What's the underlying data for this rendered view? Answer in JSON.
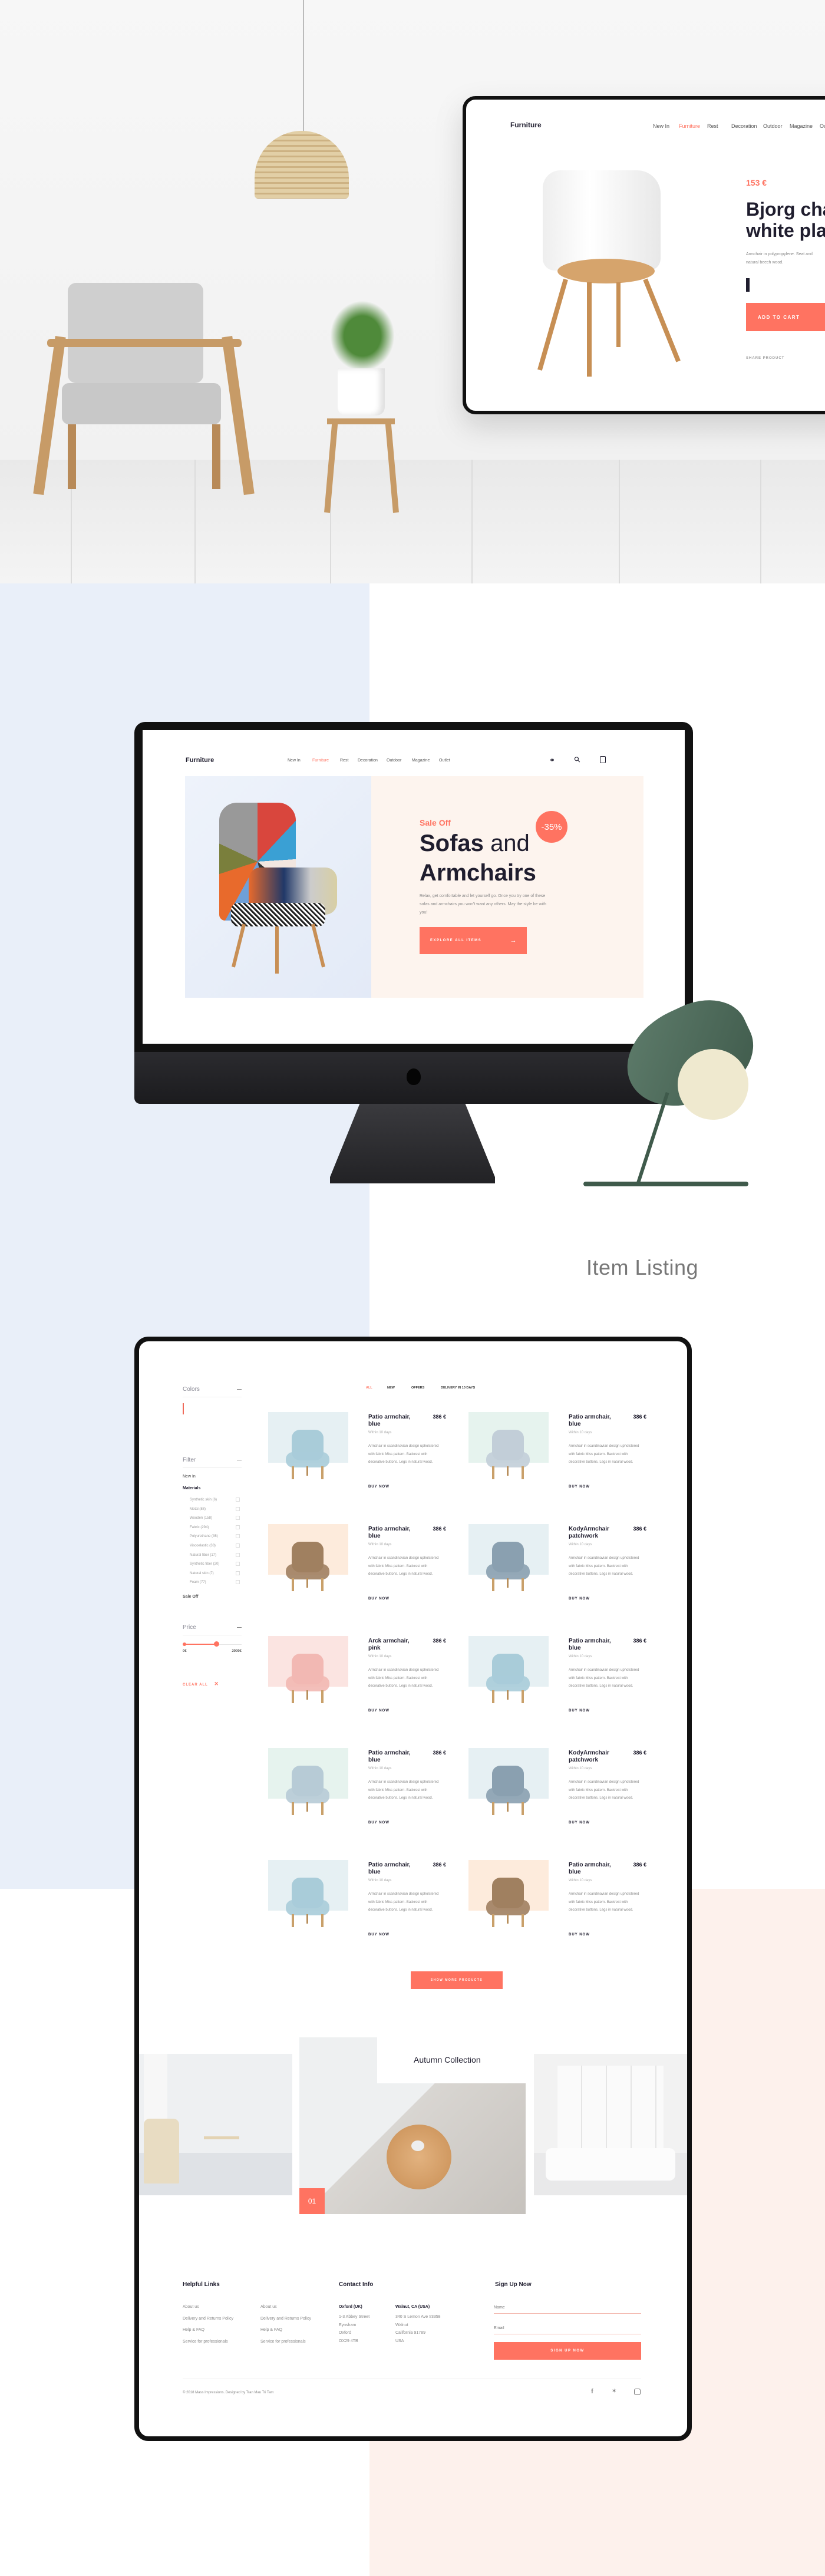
{
  "colors": {
    "accent": "#ff7361",
    "dark": "#1f1d2e",
    "blue_panel": "#e9eff9",
    "pink_panel": "#fdf1ec"
  },
  "hero_device": {
    "logo": "Furniture",
    "nav": [
      "New In",
      "Furniture",
      "Rest",
      "Decoration",
      "Outdoor",
      "Magazine",
      "Ou"
    ],
    "active_nav": 1,
    "price": "153 €",
    "title_line1": "Bjorg cha",
    "title_line2": "white pla",
    "desc_line1": "Armchair in polypropylene. Seat and",
    "desc_line2": "natural beech wood.",
    "swatches": [
      "#6a9ae0",
      "#1f1d2e",
      "#8fdcc9",
      "#ffab70"
    ],
    "selected_swatch": 1,
    "add_to_cart": "ADD TO CART",
    "share": "SHARE PRODUCT",
    "slide_count": 4,
    "active_slide": 1
  },
  "imac": {
    "logo": "Furniture",
    "nav": [
      "New In",
      "Furniture",
      "Rest",
      "Decoration",
      "Outdoor",
      "Magazine",
      "Outlet"
    ],
    "active_nav": 1,
    "icons": [
      "user-icon",
      "search-icon",
      "bag-icon"
    ],
    "sale_label": "Sale Off",
    "title_bold1": "Sofas",
    "title_light": "and",
    "title_bold2": "Armchairs",
    "discount": "-35%",
    "description": "Relax, get comfortable and let yourself go. Once you try one of these sofas and armchairs you won't want any others. May the style be with you!",
    "cta": "EXPLORE ALL ITEMS",
    "slide_count": 3,
    "active_slide": 1
  },
  "section_title": "Item Listing",
  "listing": {
    "sidebar": {
      "colors_heading": "Colors",
      "color_swatches": [
        "#6f9be0",
        "#ef6a5a",
        "#8fdcc9",
        "#ffab70",
        "#9ddbac",
        "#b0a4ec",
        "#f27c87",
        "#f7b5d6"
      ],
      "selected_color": 1,
      "filter_heading": "Filter",
      "new_in": "New In",
      "materials_heading": "Materials",
      "materials": [
        "Synthetic skin (6)",
        "Metal (88)",
        "Wooden (158)",
        "Fabric (294)",
        "Polyurethane (35)",
        "Viscoelastic (38)",
        "Natural fiber (17)",
        "Synthetic fiber (20)",
        "Natural skin (7)",
        "Foam (77)"
      ],
      "sale_off": "Sale Off",
      "price_heading": "Price",
      "price_min": "0€",
      "price_max": "2000€",
      "price_slider_value_fraction": 0.57,
      "clear_all": "CLEAR ALL"
    },
    "tabs": [
      "ALL",
      "NEW",
      "OFFERS",
      "DELIVERY IN 10 DAYS"
    ],
    "active_tab": 0,
    "products": [
      {
        "name": "Patio armchair, blue",
        "price": "386 €",
        "delivery": "Within 10 days",
        "description": "Armchair in scandinavian design upholstered with fabric Miss pattern. Backrest with decorative buttons. Legs in natural wood.",
        "cta": "BUY NOW",
        "bg": "#e6f0f3",
        "chair_color": "#a9ccd9"
      },
      {
        "name": "Patio armchair, blue",
        "price": "386 €",
        "delivery": "Within 10 days",
        "description": "Armchair in scandinavian design upholstered with fabric Miss pattern. Backrest with decorative buttons. Legs in natural wood.",
        "cta": "BUY NOW",
        "bg": "#e6f3ee",
        "chair_color": "#c2ced8"
      },
      {
        "name": "Patio armchair, blue",
        "price": "386 €",
        "delivery": "Within 10 days",
        "description": "Armchair in scandinavian design upholstered with fabric Miss pattern. Backrest with decorative buttons. Legs in natural wood.",
        "cta": "BUY NOW",
        "bg": "#fdebdc",
        "chair_color": "#a08060"
      },
      {
        "name": "KodyArmchair patchwork",
        "price": "386 €",
        "delivery": "Within 10 days",
        "description": "Armchair in scandinavian design upholstered with fabric Miss pattern. Backrest with decorative buttons. Legs in natural wood.",
        "cta": "BUY NOW",
        "bg": "#e6f0f3",
        "chair_color": "#8aa0b0"
      },
      {
        "name": "Arck armchair, pink",
        "price": "386 €",
        "delivery": "Within 10 days",
        "description": "Armchair in scandinavian design upholstered with fabric Miss pattern. Backrest with decorative buttons. Legs in natural wood.",
        "cta": "BUY NOW",
        "bg": "#fbe4e1",
        "chair_color": "#f2b8b3"
      },
      {
        "name": "Patio armchair, blue",
        "price": "386 €",
        "delivery": "Within 10 days",
        "description": "Armchair in scandinavian design upholstered with fabric Miss pattern. Backrest with decorative buttons. Legs in natural wood.",
        "cta": "BUY NOW",
        "bg": "#e6f0f3",
        "chair_color": "#a9ccd9"
      },
      {
        "name": "Patio armchair, blue",
        "price": "386 €",
        "delivery": "Within 10 days",
        "description": "Armchair in scandinavian design upholstered with fabric Miss pattern. Backrest with decorative buttons. Legs in natural wood.",
        "cta": "BUY NOW",
        "bg": "#e6f3ee",
        "chair_color": "#b7cbd6"
      },
      {
        "name": "KodyArmchair patchwork",
        "price": "386 €",
        "delivery": "Within 10 days",
        "description": "Armchair in scandinavian design upholstered with fabric Miss pattern. Backrest with decorative buttons. Legs in natural wood.",
        "cta": "BUY NOW",
        "bg": "#e6f0f3",
        "chair_color": "#8aa0b0"
      },
      {
        "name": "Patio armchair, blue",
        "price": "386 €",
        "delivery": "Within 10 days",
        "description": "Armchair in scandinavian design upholstered with fabric Miss pattern. Backrest with decorative buttons. Legs in natural wood.",
        "cta": "BUY NOW",
        "bg": "#e6f0f3",
        "chair_color": "#a9ccd9"
      },
      {
        "name": "Patio armchair, blue",
        "price": "386 €",
        "delivery": "Within 10 days",
        "description": "Armchair in scandinavian design upholstered with fabric Miss pattern. Backrest with decorative buttons. Legs in natural wood.",
        "cta": "BUY NOW",
        "bg": "#fdebdc",
        "chair_color": "#a08060"
      }
    ],
    "show_more": "SHOW MORE PRODUCTS",
    "collection": {
      "title": "Autumn Collection",
      "index": "01",
      "slide_count": 4,
      "active_slide": 1
    },
    "footer": {
      "helpful_heading": "Helpful Links",
      "links_col1": [
        "About us",
        "Delivery and Returns Policy",
        "Help & FAQ",
        "Service for professionals"
      ],
      "links_col2": [
        "About us",
        "Delivery and Returns Policy",
        "Help & FAQ",
        "Service for professionals"
      ],
      "contact_heading": "Contact Info",
      "office1": {
        "name": "Oxford (UK)",
        "lines": [
          "1-3 Abbey Street",
          "Eynsham",
          "Oxford",
          "OX29 4TB"
        ]
      },
      "office2": {
        "name": "Walnut, CA (USA)",
        "lines": [
          "340 S Lemon Ave #3358",
          "Walnut",
          "California 91789",
          "USA"
        ]
      },
      "signup_heading": "Sign Up Now",
      "name_placeholder": "Name",
      "email_placeholder": "Email",
      "signup_button": "SIGN UP NOW",
      "copyright": "© 2018 Mass Impressions. Designed by Tran Mau Tri Tam",
      "social": [
        "facebook-icon",
        "twitter-icon",
        "instagram-icon"
      ]
    }
  }
}
